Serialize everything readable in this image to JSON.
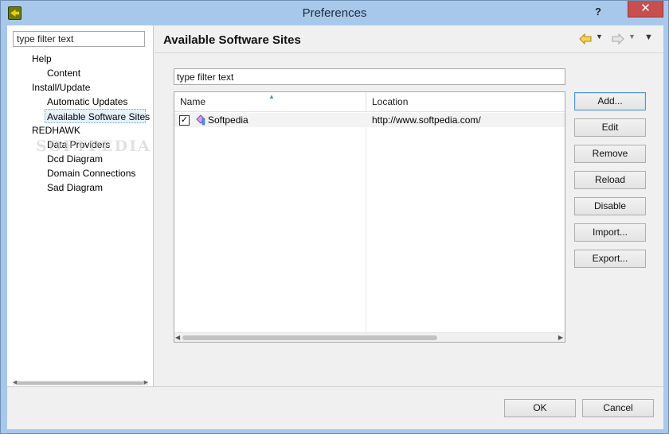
{
  "window": {
    "title": "Preferences",
    "help_glyph": "?",
    "close_glyph": "✕"
  },
  "left": {
    "filter_text": "type filter text",
    "tree": [
      {
        "label": "Help",
        "level": 0
      },
      {
        "label": "Content",
        "level": 1
      },
      {
        "label": "Install/Update",
        "level": 0
      },
      {
        "label": "Automatic Updates",
        "level": 1
      },
      {
        "label": "Available Software Sites",
        "level": 1,
        "selected": true
      },
      {
        "label": "REDHAWK",
        "level": 0
      },
      {
        "label": "Data Providers",
        "level": 1
      },
      {
        "label": "Dcd Diagram",
        "level": 1
      },
      {
        "label": "Domain Connections",
        "level": 1
      },
      {
        "label": "Sad Diagram",
        "level": 1
      }
    ],
    "watermark": "SOFTPEDIA"
  },
  "page": {
    "title": "Available Software Sites",
    "filter_text": "type filter text",
    "columns": {
      "name": "Name",
      "location": "Location"
    },
    "sites": [
      {
        "name": "Softpedia",
        "location": "http://www.softpedia.com/",
        "enabled": true
      }
    ],
    "buttons": {
      "add": "Add...",
      "edit": "Edit",
      "remove": "Remove",
      "reload": "Reload",
      "disable": "Disable",
      "import": "Import...",
      "export": "Export..."
    },
    "icons": {
      "back": "arrow-left-icon",
      "forward": "arrow-right-icon",
      "view_menu": "chevron-down-icon"
    }
  },
  "footer": {
    "ok": "OK",
    "cancel": "Cancel"
  },
  "colors": {
    "titlebar": "#a8c8eb",
    "close_button": "#c74f50",
    "selection": "#e5f1fb",
    "default_button_border": "#4f94d8"
  }
}
